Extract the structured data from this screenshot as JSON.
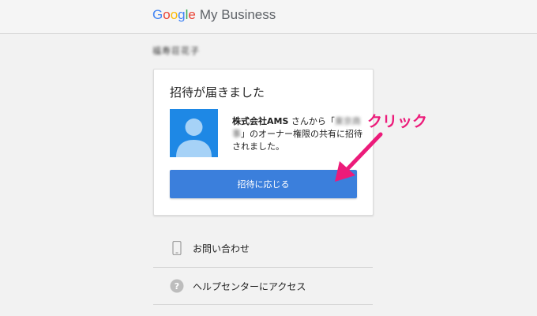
{
  "header": {
    "logo_letters": [
      "G",
      "o",
      "o",
      "g",
      "l",
      "e"
    ],
    "logo_product": "My Business"
  },
  "account": {
    "name": "福寿荘花子"
  },
  "card": {
    "title": "招待が届きました",
    "message_company": "株式会社AMS",
    "message_part1": " さんから「",
    "message_blurred": "東京商事",
    "message_part2": "」のオーナー権限の共有に招待されました。",
    "accept_label": "招待に応じる"
  },
  "annotation": {
    "text": "クリック",
    "color": "#ec1b7a"
  },
  "links": [
    {
      "icon": "phone-icon",
      "label": "お問い合わせ"
    },
    {
      "icon": "help-icon",
      "label": "ヘルプセンターにアクセス"
    }
  ],
  "colors": {
    "accent": "#3b7fdc",
    "avatar_bg": "#1e88e5",
    "annotation": "#ec1b7a"
  }
}
